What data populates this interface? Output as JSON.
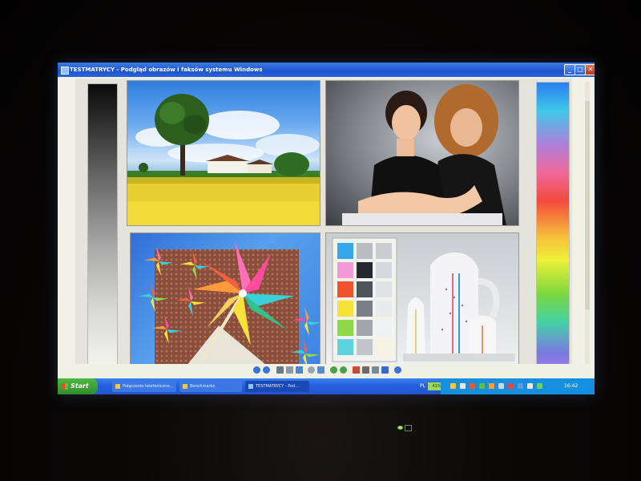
{
  "window": {
    "title": "TESTMATRYCY - Podgląd obrazów i faksów systemu Windows",
    "background_text_left": "",
    "background_text_right": "",
    "controls": {
      "minimize": "_",
      "maximize": "□",
      "close": "✕"
    }
  },
  "viewer": {
    "images": [
      {
        "name": "landscape-photo",
        "kind": "image"
      },
      {
        "name": "portrait-photo",
        "kind": "image"
      },
      {
        "name": "pinwheel-photo",
        "kind": "image"
      },
      {
        "name": "color-swatch-photo",
        "kind": "image"
      }
    ],
    "gray_gradient_bar": true,
    "rainbow_gradient_bar": true
  },
  "toolbar": {
    "icons": [
      "previous-icon",
      "next-icon",
      "best-fit-icon",
      "actual-size-icon",
      "slideshow-icon",
      "zoom-in-icon",
      "zoom-out-icon",
      "rotate-cw-icon",
      "rotate-ccw-icon",
      "delete-icon",
      "print-icon",
      "copy-icon",
      "edit-icon",
      "close-icon",
      "help-icon"
    ]
  },
  "taskbar": {
    "start_label": "Start",
    "tasks": [
      {
        "label": "Połączenie telefoniczne..."
      },
      {
        "label": "Benchmarks"
      },
      {
        "label": "TESTMATRYCY - Pod..."
      }
    ],
    "language": "PL",
    "meter": "41%",
    "clock": "16:42"
  },
  "colors": {
    "title_bar": "#1c55cf",
    "taskbar": "#245fdc",
    "start_button": "#2f8d2a",
    "tray": "#1590e0"
  },
  "swatch_colors": [
    [
      "#35a8e8",
      "#b9bcc0",
      "#c9ccd0"
    ],
    [
      "#f29ad6",
      "#262a30",
      "#d5d8dc"
    ],
    [
      "#f0522c",
      "#4f545c",
      "#e0e3e6"
    ],
    [
      "#f6e23a",
      "#7a7f86",
      "#e8eaec"
    ],
    [
      "#8fd84a",
      "#a2a6ac",
      "#f0f1f2"
    ],
    [
      "#5fd2e0",
      "#c2c5ca",
      "#f8f2e2"
    ]
  ]
}
